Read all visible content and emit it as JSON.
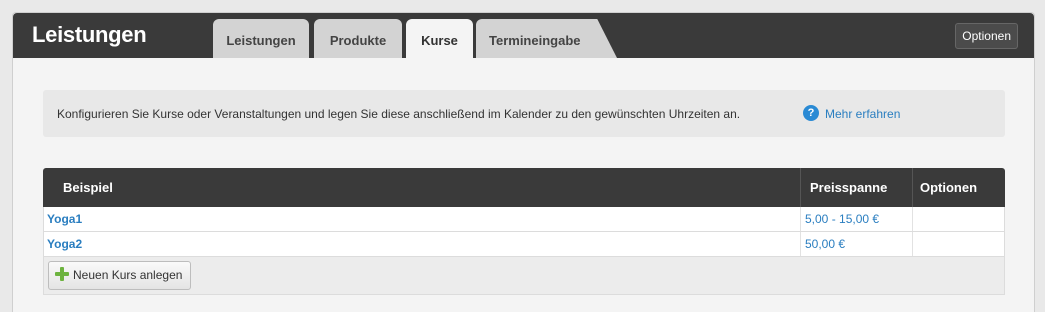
{
  "header": {
    "title": "Leistungen",
    "options_label": "Optionen",
    "tabs": [
      {
        "label": "Leistungen",
        "active": false
      },
      {
        "label": "Produkte",
        "active": false
      },
      {
        "label": "Kurse",
        "active": true
      },
      {
        "label": "Termineingabe",
        "active": false
      }
    ]
  },
  "info": {
    "text": "Konfigurieren Sie Kurse oder Veranstaltungen und legen Sie diese anschließend im Kalender zu den gewünschten Uhrzeiten an.",
    "help_icon": "question-circle-icon",
    "link": "Mehr erfahren"
  },
  "table": {
    "columns": [
      "Beispiel",
      "Preisspanne",
      "Optionen"
    ],
    "rows": [
      {
        "name": "Yoga1",
        "price": "5,00 - 15,00 €",
        "options": ""
      },
      {
        "name": "Yoga2",
        "price": "50,00 €",
        "options": ""
      }
    ],
    "new_button_label": "Neuen Kurs anlegen",
    "new_button_icon": "plus-icon"
  },
  "colors": {
    "header_bg": "#3a3a3a",
    "link": "#2a7ec0",
    "plus_icon": "#6db33f"
  }
}
